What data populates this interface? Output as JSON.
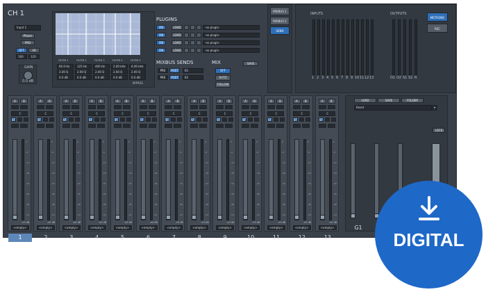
{
  "header": {
    "title": "CH 1"
  },
  "input": {
    "source": "Input 1",
    "phase_label": "Phase",
    "pad_label": "PAD",
    "hpf_toggle": "OFF",
    "hpf_label": "HI",
    "hpf_lo": "100",
    "hpf_hi": "120",
    "gain_label": "GAIN",
    "gain_value": "0.0 dB"
  },
  "eq": {
    "filters": [
      {
        "name": "FILTER 1",
        "freq": "60.0 Hz",
        "q": "2.00 Q",
        "gain": "0.0 dB"
      },
      {
        "name": "FILTER 2",
        "freq": "125 Hz",
        "q": "2.00 Q",
        "gain": "0.0 dB"
      },
      {
        "name": "FILTER 3",
        "freq": "400 Hz",
        "q": "2.00 Q",
        "gain": "0.0 dB"
      },
      {
        "name": "FILTER 4",
        "freq": "2.00 kHz",
        "q": "2.00 Q",
        "gain": "0.0 dB"
      },
      {
        "name": "FILTER 5",
        "freq": "6.00 kHz",
        "q": "2.00 Q",
        "gain": "0.0 dB"
      }
    ],
    "bypass_label": "BYPASS"
  },
  "plugins": {
    "title": "PLUGINS",
    "slots": [
      {
        "on": "ON",
        "load": "LOAD",
        "name": "-no plugin-"
      },
      {
        "on": "ON",
        "load": "LOAD",
        "name": "-no plugin-"
      },
      {
        "on": "ON",
        "load": "LOAD",
        "name": "-no plugin-"
      },
      {
        "on": "ON",
        "load": "LOAD",
        "name": "-no plugin-"
      }
    ]
  },
  "mixbus_sends": {
    "title": "MIXBUS SENDS",
    "rows": [
      {
        "pre": "PRE",
        "post": "POST",
        "name": "B1"
      },
      {
        "pre": "PRE",
        "post": "POST",
        "name": "B2"
      }
    ]
  },
  "mix": {
    "title": "MIX",
    "save": "SAVE",
    "off": "OFF",
    "auto": "AUTO",
    "follow": "FOLLOW"
  },
  "mixbus_buttons": [
    "MIXBUS 1",
    "MIXBUS 2",
    "SEND"
  ],
  "inputs": {
    "title": "INPUTS",
    "labels": [
      "1",
      "2",
      "3",
      "4",
      "5",
      "6",
      "7",
      "8",
      "9",
      "10",
      "11",
      "12",
      "13"
    ]
  },
  "outputs": {
    "title": "OUTPUTS",
    "labels": [
      "O1",
      "O2",
      "S1",
      "S2",
      "R"
    ],
    "metronome": "METRONO",
    "rec": "REC"
  },
  "channels": {
    "numbers": [
      "1",
      "2",
      "3",
      "4",
      "5",
      "6",
      "7",
      "8",
      "9",
      "10",
      "11",
      "12",
      "13"
    ],
    "pan_value": "C",
    "fader_value": "-inf dB",
    "name": "<empty>",
    "scale": [
      "0",
      "-6",
      "-12",
      "-18",
      "-24",
      "-36",
      "-48",
      "-inf"
    ]
  },
  "group": {
    "load": "LOAD",
    "save": "SAVE",
    "folder": "FOLDER",
    "preset": "Reset",
    "lock": "LOCK",
    "label": "G1"
  },
  "badge": {
    "label": "DIGITAL",
    "icon": "download-icon"
  }
}
